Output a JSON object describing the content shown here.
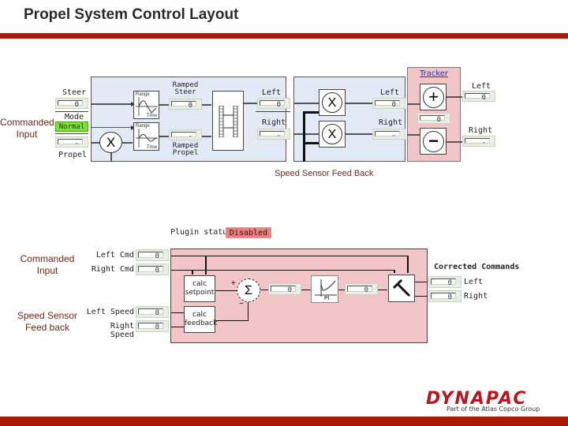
{
  "title": "Propel System Control Layout",
  "colors": {
    "brand_red": "#a01e0a",
    "panel_blue": "#e4eaf5",
    "panel_pink": "#f2c5c8",
    "mode_green": "#7ee032",
    "status_red": "#f07c7c",
    "tracker_link": "#2a2acc"
  },
  "top_diagram": {
    "side_label": "Commanded Input",
    "inputs": {
      "steer_label": "Steer",
      "steer_value": "0",
      "mode_label": "Mode",
      "mode_value": "Normal",
      "propel_label": "Propel",
      "propel_value": "-"
    },
    "ramp": {
      "range_label": "Range",
      "time_label": "Time",
      "ramped_steer_label": "Ramped Steer",
      "ramped_steer_value": "0",
      "ramped_propel_label": "Ramped Propel",
      "ramped_propel_value": "-"
    },
    "multiplier_symbol": "X",
    "mixer_outputs": {
      "left_label": "Left",
      "left_value": "0",
      "right_label": "Right",
      "right_value": "-"
    },
    "gain_outputs": {
      "left_label": "Left",
      "left_value": "0",
      "right_label": "Right",
      "right_value": "-"
    },
    "tracker": {
      "title": "Tracker",
      "plus_symbol": "+",
      "minus_symbol": "−",
      "middle_value": "0"
    },
    "tracker_outputs": {
      "left_label": "Left",
      "left_value": "0",
      "right_label": "Right",
      "right_value": "-"
    },
    "feedback_caption": "Speed Sensor Feed Back"
  },
  "bottom_diagram": {
    "plugin_status_label": "Plugin status",
    "plugin_status_value": "Disabled",
    "commanded_label": "Commanded Input",
    "speed_label": "Speed Sensor Feed back",
    "inputs": [
      {
        "label": "Left Cmd",
        "value": "0"
      },
      {
        "label": "Right Cmd",
        "value": "0"
      },
      {
        "label": "Left Speed",
        "value": "0"
      },
      {
        "label": "Right Speed",
        "value": "0"
      }
    ],
    "calc_setpoint": "calc setpoint",
    "calc_feedback": "calc feedback",
    "sum_symbol": "Σ",
    "plus_sign": "+",
    "minus_sign": "−",
    "error_value": "0",
    "pi_label": "PI",
    "pi_output_value": "0",
    "corrected_title": "Corrected Commands",
    "outputs": [
      {
        "label": "Left",
        "value": "0"
      },
      {
        "label": "Right",
        "value": "0"
      }
    ]
  },
  "logo": {
    "name": "DYNAPAC",
    "tagline": "Part of the Atlas Copco Group"
  }
}
